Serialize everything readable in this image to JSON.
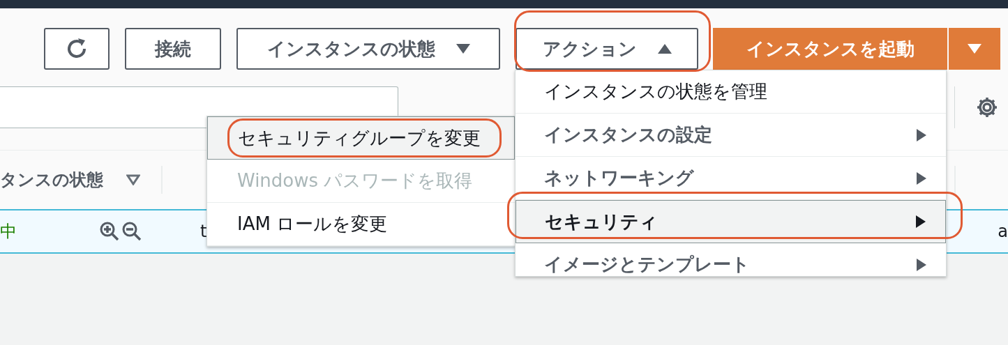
{
  "toolbar": {
    "connect_button": {
      "label": "接続"
    },
    "state_dropdown": {
      "label": "インスタンスの状態",
      "expanded": false
    },
    "actions_dropdown": {
      "label": "アクション",
      "expanded": true,
      "annotated": true
    },
    "launch_button": {
      "label": "インスタンスを起動"
    }
  },
  "table": {
    "columns": [
      {
        "label": "タンスの状態",
        "filter": true
      }
    ],
    "rows": [
      {
        "selected": true,
        "cells": [
          {
            "kind": "status",
            "text": "中"
          },
          {
            "kind": "zoom"
          },
          {
            "kind": "text",
            "text": "t"
          },
          {
            "kind": "text",
            "text": "a"
          }
        ]
      }
    ]
  },
  "actions_menu": {
    "items": [
      {
        "label": "インスタンスの状態を管理",
        "kind": "action",
        "selected": false,
        "annotated": false
      },
      {
        "label": "インスタンスの設定",
        "kind": "submenu",
        "selected": false,
        "annotated": false
      },
      {
        "label": "ネットワーキング",
        "kind": "submenu",
        "selected": false,
        "annotated": false
      },
      {
        "label": "セキュリティ",
        "kind": "submenu",
        "selected": true,
        "annotated": true
      },
      {
        "label": "イメージとテンプレート",
        "kind": "submenu",
        "selected": false,
        "annotated": false
      }
    ]
  },
  "security_submenu": {
    "items": [
      {
        "label": "セキュリティグループを変更",
        "selected": true,
        "disabled": false,
        "annotated": true
      },
      {
        "label": "Windows パスワードを取得",
        "selected": false,
        "disabled": true,
        "annotated": false
      },
      {
        "label": "IAM ロールを変更",
        "selected": false,
        "disabled": false,
        "annotated": false
      }
    ]
  }
}
